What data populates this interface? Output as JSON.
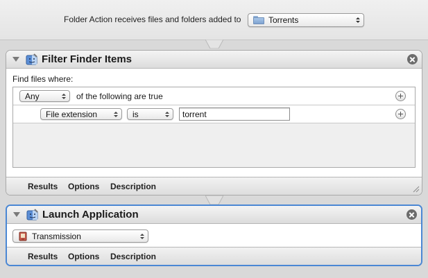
{
  "header": {
    "label": "Folder Action receives files and folders added to",
    "folder": "Torrents",
    "folder_icon": "folder-icon"
  },
  "filter_action": {
    "title": "Filter Finder Items",
    "icon": "finder-icon",
    "find_label": "Find files where:",
    "match_mode": "Any",
    "match_text": "of the following are true",
    "criterion": {
      "attribute": "File extension",
      "operator": "is",
      "value": "torrent"
    },
    "footer": [
      "Results",
      "Options",
      "Description"
    ]
  },
  "launch_action": {
    "title": "Launch Application",
    "icon": "finder-icon",
    "application": "Transmission",
    "footer": [
      "Results",
      "Options",
      "Description"
    ]
  },
  "colors": {
    "selection": "#4a87d4",
    "background": "#d9d9d9"
  }
}
